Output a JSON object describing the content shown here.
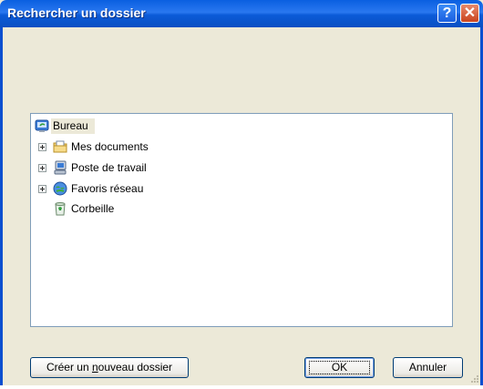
{
  "window": {
    "title": "Rechercher un dossier",
    "help_glyph": "?",
    "close_glyph": "✕"
  },
  "tree": {
    "items": [
      {
        "label": "Bureau",
        "icon": "desktop-icon",
        "expandable": false,
        "selected": true
      },
      {
        "label": "Mes documents",
        "icon": "folder-documents-icon",
        "expandable": true
      },
      {
        "label": "Poste de travail",
        "icon": "my-computer-icon",
        "expandable": true
      },
      {
        "label": "Favoris réseau",
        "icon": "network-places-icon",
        "expandable": true
      },
      {
        "label": "Corbeille",
        "icon": "recycle-bin-icon",
        "expandable": false
      }
    ]
  },
  "buttons": {
    "new_folder_pre": "Créer un ",
    "new_folder_accel": "n",
    "new_folder_post": "ouveau dossier",
    "ok": "OK",
    "cancel": "Annuler"
  },
  "colors": {
    "titlebar": "#0a5fe0",
    "dialog_bg": "#ece9d8",
    "close_button": "#c9441f"
  }
}
